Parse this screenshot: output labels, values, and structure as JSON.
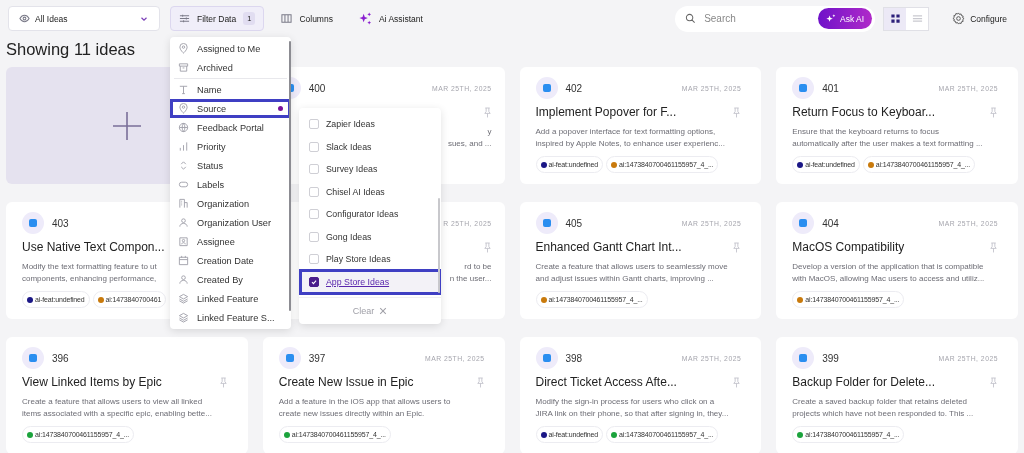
{
  "toolbar": {
    "view_select": "All Ideas",
    "filter": {
      "label": "Filter Data",
      "count": "1",
      "active": true
    },
    "columns": "Columns",
    "assistant": "Ai Assistant",
    "search": {
      "placeholder": "Search"
    },
    "ask_ai": "Ask AI",
    "views": [
      {
        "kind": "grid",
        "selected": true
      },
      {
        "kind": "list",
        "selected": false
      }
    ],
    "configure": "Configure"
  },
  "heading": "Showing 11 ideas",
  "cards": [
    {
      "kind": "add"
    },
    {
      "kind": "covered",
      "number": "400",
      "date": "MAR 25TH, 2025",
      "lines": [
        "y",
        "sues, and ..."
      ]
    },
    {
      "kind": "full",
      "number": "402",
      "date": "MAR 25TH, 2025",
      "title": "Implement Popover for F...",
      "lines": [
        "Add a popover interface for text formatting options,",
        "inspired by Apple Notes, to enhance user experienc..."
      ],
      "tags": [
        {
          "label": "ai-feat:undefined",
          "color": "#1b1786"
        },
        {
          "label": "ai:1473840700461155957_4_...",
          "color": "#c97a0c"
        }
      ]
    },
    {
      "kind": "full",
      "number": "401",
      "date": "MAR 25TH, 2025",
      "title": "Return Focus to Keyboar...",
      "lines": [
        "Ensure that the keyboard returns to focus",
        "automatically after the user makes a text formatting ..."
      ],
      "tags": [
        {
          "label": "ai-feat:undefined",
          "color": "#1b1786"
        },
        {
          "label": "ai:1473840700461155957_4_...",
          "color": "#c97a0c"
        }
      ]
    },
    {
      "kind": "partial",
      "number": "403",
      "title": "Use Native Text Compon...",
      "lines": [
        "Modify the text formatting feature to ut",
        "components, enhancing performance,"
      ],
      "tags": [
        {
          "label": "ai-feat:undefined",
          "color": "#1b1786"
        },
        {
          "label": "ai:1473840700461",
          "color": "#c97a0c"
        }
      ]
    },
    {
      "kind": "covered",
      "date": "R 25TH, 2025",
      "lines": [
        "rd to be",
        "n the user..."
      ]
    },
    {
      "kind": "full",
      "number": "405",
      "date": "MAR 25TH, 2025",
      "title": "Enhanced Gantt Chart Int...",
      "lines": [
        "Create a feature that allows users to seamlessly move",
        "and adjust issues within Gantt charts, improving ..."
      ],
      "tags": [
        {
          "label": "ai:1473840700461155957_4_...",
          "color": "#c97a0c"
        }
      ]
    },
    {
      "kind": "full",
      "number": "404",
      "date": "MAR 25TH, 2025",
      "title": "MacOS Compatibility",
      "lines": [
        "Develop a version of the application that is compatible",
        "with MacOS, allowing Mac users to access and utiliz..."
      ],
      "tags": [
        {
          "label": "ai:1473840700461155957_4_...",
          "color": "#c97a0c"
        }
      ]
    },
    {
      "kind": "full",
      "number": "396",
      "title": "View Linked Items by Epic",
      "lines": [
        "Create a feature that allows users to view all linked",
        "items associated with a specific epic, enabling bette..."
      ],
      "tags": [
        {
          "label": "ai:1473840700461155957_4_...",
          "color": "#1ba33c"
        }
      ]
    },
    {
      "kind": "full",
      "number": "397",
      "date": "MAR 25TH, 2025",
      "title": "Create New Issue in Epic",
      "lines": [
        "Add a feature in the iOS app that allows users to",
        "create new issues directly within an Epic."
      ],
      "tags": [
        {
          "label": "ai:1473840700461155957_4_...",
          "color": "#1ba33c"
        }
      ]
    },
    {
      "kind": "full",
      "number": "398",
      "date": "MAR 25TH, 2025",
      "title": "Direct Ticket Access Afte...",
      "lines": [
        "Modify the sign-in process for users who click on a",
        "JIRA link on their phone, so that after signing in, they..."
      ],
      "tags": [
        {
          "label": "ai-feat:undefined",
          "color": "#1b1786"
        },
        {
          "label": "ai:1473840700461155957_4_...",
          "color": "#1ba33c"
        }
      ]
    },
    {
      "kind": "full",
      "number": "399",
      "date": "MAR 25TH, 2025",
      "title": "Backup Folder for Delete...",
      "lines": [
        "Create a saved backup folder that retains deleted",
        "projects which have not been responded to. This ..."
      ],
      "tags": [
        {
          "label": "ai:1473840700461155957_4_...",
          "color": "#1ba33c"
        }
      ]
    }
  ],
  "filter_menu": {
    "sections": [
      [
        {
          "label": "Assigned to Me",
          "highlighted": false,
          "filtered": false
        },
        {
          "label": "Archived",
          "highlighted": false,
          "filtered": false
        }
      ],
      [
        {
          "label": "Name",
          "highlighted": false,
          "filtered": false
        },
        {
          "label": "Source",
          "highlighted": true,
          "filtered": true
        },
        {
          "label": "Feedback Portal",
          "highlighted": false,
          "filtered": false
        },
        {
          "label": "Priority",
          "highlighted": false,
          "filtered": false
        },
        {
          "label": "Status",
          "highlighted": false,
          "filtered": false
        },
        {
          "label": "Labels",
          "highlighted": false,
          "filtered": false
        },
        {
          "label": "Organization",
          "highlighted": false,
          "filtered": false
        },
        {
          "label": "Organization User",
          "highlighted": false,
          "filtered": false
        },
        {
          "label": "Assignee",
          "highlighted": false,
          "filtered": false
        },
        {
          "label": "Creation Date",
          "highlighted": false,
          "filtered": false
        },
        {
          "label": "Created By",
          "highlighted": false,
          "filtered": false
        },
        {
          "label": "Linked Feature",
          "highlighted": false,
          "filtered": false
        },
        {
          "label": "Linked Feature S...",
          "highlighted": false,
          "filtered": false
        }
      ]
    ]
  },
  "source_menu": {
    "options": [
      {
        "label": "Zapier Ideas",
        "checked": false,
        "highlighted": false
      },
      {
        "label": "Slack Ideas",
        "checked": false,
        "highlighted": false
      },
      {
        "label": "Survey Ideas",
        "checked": false,
        "highlighted": false
      },
      {
        "label": "Chisel AI Ideas",
        "checked": false,
        "highlighted": false
      },
      {
        "label": "Configurator Ideas",
        "checked": false,
        "highlighted": false
      },
      {
        "label": "Gong Ideas",
        "checked": false,
        "highlighted": false
      },
      {
        "label": "Play Store Ideas",
        "checked": false,
        "highlighted": false
      },
      {
        "label": "App Store Ideas",
        "checked": true,
        "highlighted": true
      }
    ],
    "clear": "Clear"
  }
}
